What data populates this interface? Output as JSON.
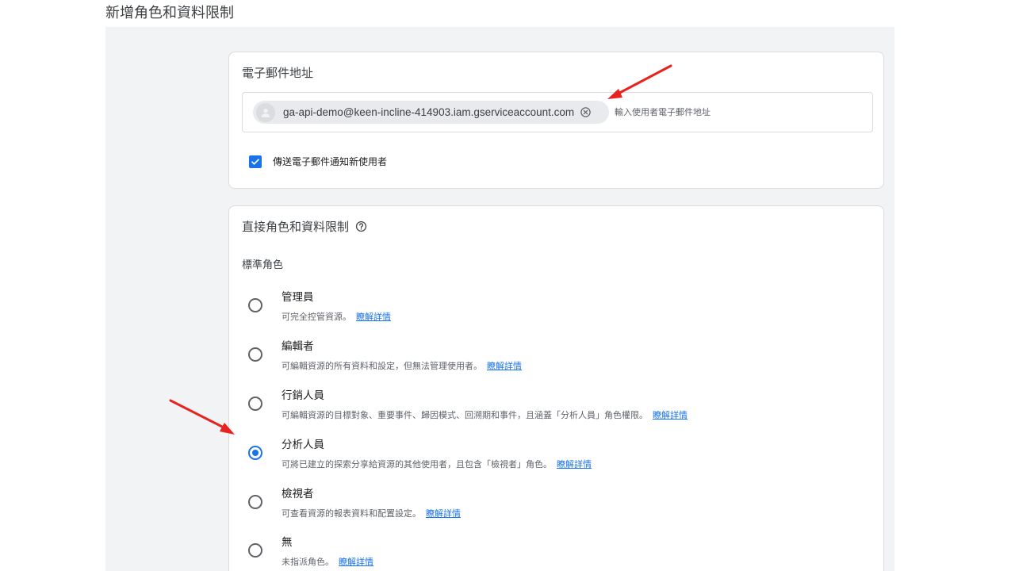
{
  "page": {
    "title": "新增角色和資料限制"
  },
  "email_card": {
    "title": "電子郵件地址",
    "chip_email": "ga-api-demo@keen-incline-414903.iam.gserviceaccount.com",
    "input_placeholder": "輸入使用者電子郵件地址",
    "notify_label": "傳送電子郵件通知新使用者",
    "notify_checked": true
  },
  "roles_card": {
    "title": "直接角色和資料限制",
    "section_label": "標準角色",
    "roles": [
      {
        "name": "管理員",
        "desc": "可完全控管資源。",
        "link": "瞭解詳情",
        "selected": false
      },
      {
        "name": "編輯者",
        "desc": "可編輯資源的所有資料和設定，但無法管理使用者。",
        "link": "瞭解詳情",
        "selected": false
      },
      {
        "name": "行銷人員",
        "desc": "可編輯資源的目標對象、重要事件、歸因模式、回溯期和事件，且涵蓋「分析人員」角色權限。",
        "link": "瞭解詳情",
        "selected": false
      },
      {
        "name": "分析人員",
        "desc": "可將已建立的探索分享給資源的其他使用者，且包含「檢視者」角色。",
        "link": "瞭解詳情",
        "selected": true
      },
      {
        "name": "檢視者",
        "desc": "可查看資源的報表資料和配置設定。",
        "link": "瞭解詳情",
        "selected": false
      },
      {
        "name": "無",
        "desc": "未指派角色。",
        "link": "瞭解詳情",
        "selected": false
      }
    ]
  },
  "colors": {
    "accent": "#1a73e8",
    "annotation_arrow": "#e8231f"
  },
  "icons": [
    "person-icon",
    "remove-chip-icon",
    "checkmark-icon",
    "help-icon",
    "annotation-arrow"
  ]
}
